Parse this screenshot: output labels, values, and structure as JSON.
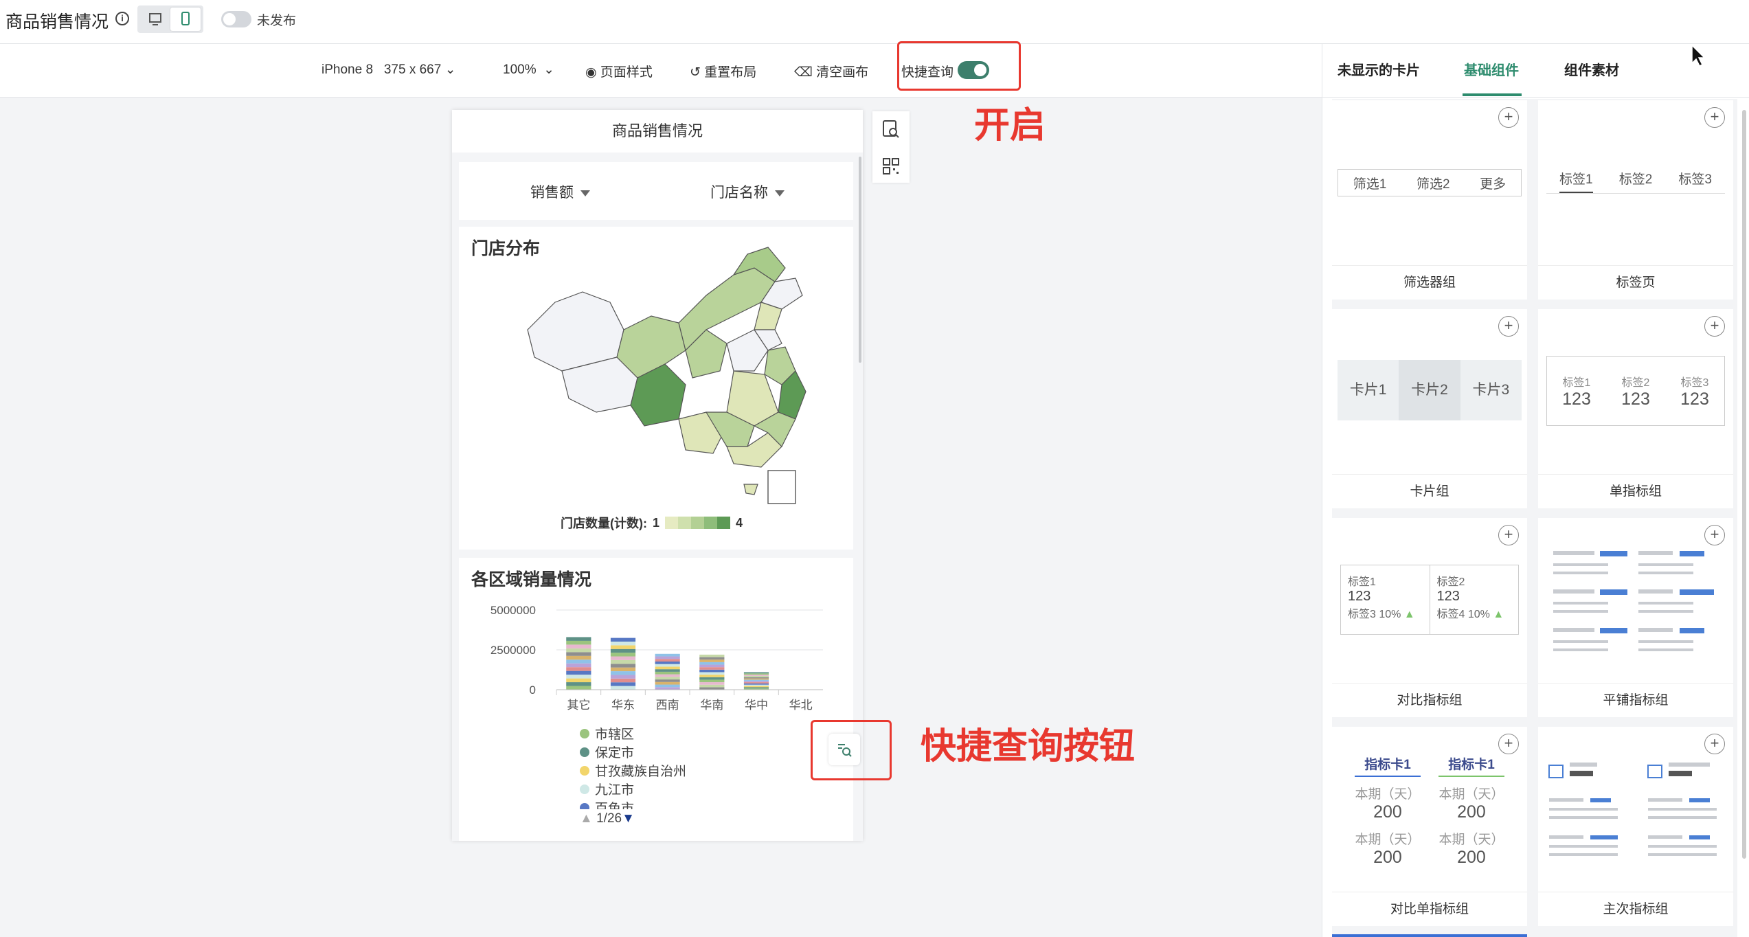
{
  "app": {
    "title": "商品销售情况",
    "publish_state": "未发布"
  },
  "toolbar": {
    "device": "iPhone 8",
    "resolution": "375 x 667",
    "zoom": "100%",
    "page_style": "页面样式",
    "reset_layout": "重置布局",
    "clear_canvas": "清空画布",
    "quick_query": "快捷查询"
  },
  "annotations": {
    "enable": "开启",
    "quick_button": "快捷查询按钮"
  },
  "phone": {
    "header": "商品销售情况",
    "filters": [
      "销售额",
      "门店名称"
    ],
    "map_card": {
      "title": "门店分布",
      "legend_label": "门店数量(计数):",
      "legend_min": "1",
      "legend_max": "4"
    },
    "bar_card": {
      "title": "各区域销量情况",
      "legend_items": [
        "市辖区",
        "保定市",
        "甘孜藏族自治州",
        "九江市",
        "百色市"
      ],
      "pager": "1/26"
    }
  },
  "chart_data": {
    "type": "bar",
    "title": "各区域销量情况",
    "categories": [
      "其它",
      "华东",
      "西南",
      "华南",
      "华中",
      "华北"
    ],
    "values": [
      3300000,
      3250000,
      2250000,
      2200000,
      1100000,
      0
    ],
    "y_ticks": [
      "5000000",
      "2500000",
      "0"
    ],
    "ylim": [
      0,
      5000000
    ]
  },
  "right_panel": {
    "tabs": [
      "未显示的卡片",
      "基础组件",
      "组件素材"
    ],
    "active_tab": "基础组件",
    "components": [
      {
        "label": "筛选器组",
        "preview": [
          "筛选1",
          "筛选2",
          "更多"
        ]
      },
      {
        "label": "标签页",
        "preview": [
          "标签1",
          "标签2",
          "标签3"
        ]
      },
      {
        "label": "卡片组",
        "preview": [
          "卡片1",
          "卡片2",
          "卡片3"
        ]
      },
      {
        "label": "单指标组",
        "preview_labels": [
          "标签1",
          "标签2",
          "标签3"
        ],
        "preview_values": [
          "123",
          "123",
          "123"
        ]
      },
      {
        "label": "对比指标组",
        "preview": {
          "a_label": "标签1",
          "a_value": "123",
          "a_sub": "标签3 10%",
          "b_label": "标签2",
          "b_value": "123",
          "b_sub": "标签4 10%"
        }
      },
      {
        "label": "平铺指标组"
      },
      {
        "label": "对比单指标组",
        "preview": {
          "h1": "指标卡1",
          "h2": "指标卡1",
          "period": "本期（天）",
          "value": "200"
        }
      },
      {
        "label": "主次指标组"
      }
    ]
  },
  "colors": {
    "accent": "#2e8c6e",
    "switch_on": "#3d7f6c",
    "annotation_red": "#e8382f"
  }
}
